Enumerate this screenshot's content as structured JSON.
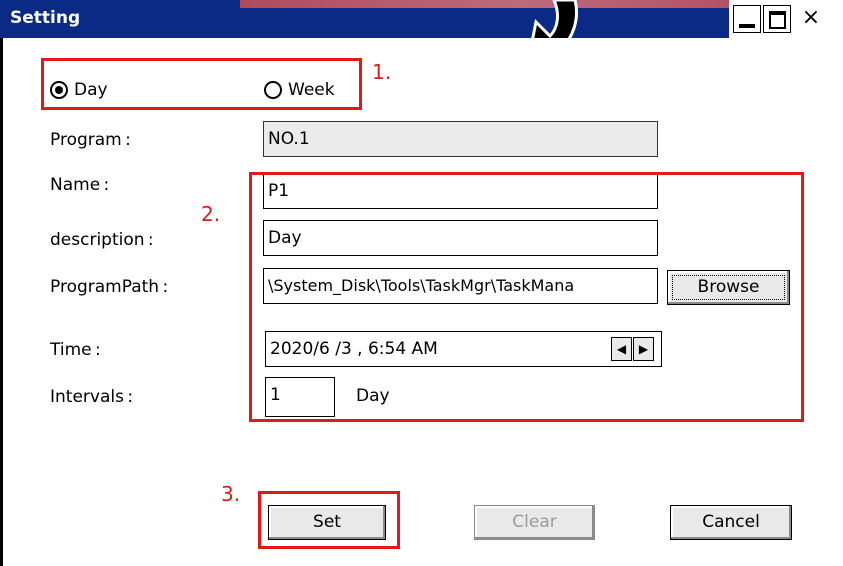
{
  "window": {
    "title": "Setting",
    "close_glyph": "×"
  },
  "schedule": {
    "day_label": "Day",
    "week_label": "Week",
    "selected": "Day"
  },
  "form": {
    "program_label": "Program :",
    "program_value": "NO.1",
    "name_label": "Name :",
    "name_value": "P1",
    "description_label": "description :",
    "description_value": "Day",
    "path_label": "ProgramPath :",
    "path_value": "\\System_Disk\\Tools\\TaskMgr\\TaskMana",
    "browse_label": "Browse",
    "time_label": "Time :",
    "time_value": "2020/6 /3 ,  6:54 AM",
    "intervals_label": "Intervals :",
    "intervals_value": "1",
    "intervals_unit": "Day"
  },
  "buttons": {
    "set": "Set",
    "clear": "Clear",
    "cancel": "Cancel"
  },
  "annotations": {
    "a1": "1.",
    "a2": "2.",
    "a3": "3."
  },
  "colors": {
    "titlebar": "#0a2a86",
    "annotation": "#e01919"
  }
}
